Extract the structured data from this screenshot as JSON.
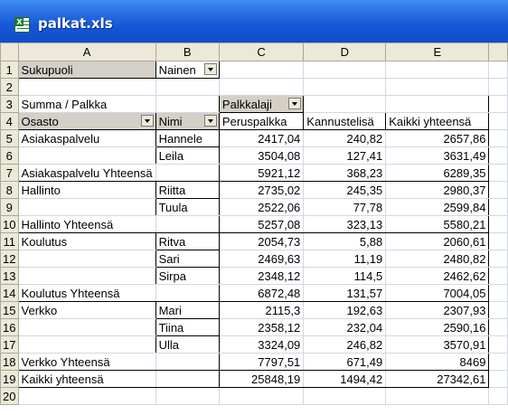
{
  "window": {
    "title": "palkat.xls"
  },
  "columns": [
    "A",
    "B",
    "C",
    "D",
    "E"
  ],
  "rows": [
    "1",
    "2",
    "3",
    "4",
    "5",
    "6",
    "7",
    "8",
    "9",
    "10",
    "11",
    "12",
    "13",
    "14",
    "15",
    "16",
    "17",
    "18",
    "19",
    "20"
  ],
  "page_field": {
    "label": "Sukupuoli",
    "value": "Nainen"
  },
  "pivot": {
    "data_field": "Summa / Palkka",
    "column_field": "Palkkalaji",
    "row_headers": [
      "Osasto",
      "Nimi"
    ],
    "value_headers": [
      "Peruspalkka",
      "Kannustelisä",
      "Kaikki yhteensä"
    ],
    "rows": [
      {
        "osasto": "Asiakaspalvelu",
        "nimi": "Hannele",
        "peruspalkka": "2417,04",
        "kannustelisa": "240,82",
        "yhteensa": "2657,86"
      },
      {
        "osasto": "",
        "nimi": "Leila",
        "peruspalkka": "3504,08",
        "kannustelisa": "127,41",
        "yhteensa": "3631,49"
      },
      {
        "osasto": "Asiakaspalvelu Yhteensä",
        "nimi": "",
        "peruspalkka": "5921,12",
        "kannustelisa": "368,23",
        "yhteensa": "6289,35"
      },
      {
        "osasto": "Hallinto",
        "nimi": "Riitta",
        "peruspalkka": "2735,02",
        "kannustelisa": "245,35",
        "yhteensa": "2980,37"
      },
      {
        "osasto": "",
        "nimi": "Tuula",
        "peruspalkka": "2522,06",
        "kannustelisa": "77,78",
        "yhteensa": "2599,84"
      },
      {
        "osasto": "Hallinto Yhteensä",
        "nimi": "",
        "peruspalkka": "5257,08",
        "kannustelisa": "323,13",
        "yhteensa": "5580,21"
      },
      {
        "osasto": "Koulutus",
        "nimi": "Ritva",
        "peruspalkka": "2054,73",
        "kannustelisa": "5,88",
        "yhteensa": "2060,61"
      },
      {
        "osasto": "",
        "nimi": "Sari",
        "peruspalkka": "2469,63",
        "kannustelisa": "11,19",
        "yhteensa": "2480,82"
      },
      {
        "osasto": "",
        "nimi": "Sirpa",
        "peruspalkka": "2348,12",
        "kannustelisa": "114,5",
        "yhteensa": "2462,62"
      },
      {
        "osasto": "Koulutus Yhteensä",
        "nimi": "",
        "peruspalkka": "6872,48",
        "kannustelisa": "131,57",
        "yhteensa": "7004,05"
      },
      {
        "osasto": "Verkko",
        "nimi": "Mari",
        "peruspalkka": "2115,3",
        "kannustelisa": "192,63",
        "yhteensa": "2307,93"
      },
      {
        "osasto": "",
        "nimi": "Tiina",
        "peruspalkka": "2358,12",
        "kannustelisa": "232,04",
        "yhteensa": "2590,16"
      },
      {
        "osasto": "",
        "nimi": "Ulla",
        "peruspalkka": "3324,09",
        "kannustelisa": "246,82",
        "yhteensa": "3570,91"
      },
      {
        "osasto": "Verkko Yhteensä",
        "nimi": "",
        "peruspalkka": "7797,51",
        "kannustelisa": "671,49",
        "yhteensa": "8469"
      },
      {
        "osasto": "Kaikki yhteensä",
        "nimi": "",
        "peruspalkka": "25848,19",
        "kannustelisa": "1494,42",
        "yhteensa": "27342,61"
      }
    ]
  },
  "colors": {
    "titlebar": "#1657d6",
    "header_bg": "#ece9d8",
    "gridline": "#d0d7e5"
  }
}
